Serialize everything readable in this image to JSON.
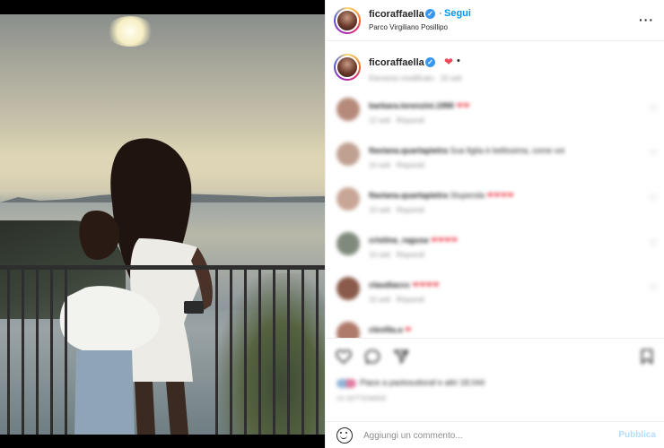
{
  "post": {
    "username": "ficoraffaella",
    "verified": true,
    "follow_label": "Segui",
    "location": "Parco Virgiliano Posillipo",
    "more_icon": "more-horizontal-icon"
  },
  "caption": {
    "username": "ficoraffaella",
    "heart": "❤",
    "suffix": "•",
    "meta": "Elemento modificato · 19 sett"
  },
  "comments": [
    {
      "user": "barbara.lorenzini.1990",
      "text": "",
      "hearts": "❤❤",
      "time": "12 sett",
      "reply": "Rispondi"
    },
    {
      "user": "flaviana.quartapietra",
      "text": "Sua figlia è bellissima, come voi",
      "hearts": "",
      "time": "10 sett",
      "reply": "Rispondi"
    },
    {
      "user": "flaviana.quartapietra",
      "text": "Stupenda",
      "hearts": "❤❤❤❤",
      "time": "10 sett",
      "reply": "Rispondi"
    },
    {
      "user": "cristina_ragusa",
      "text": "",
      "hearts": "❤❤❤❤",
      "time": "10 sett",
      "reply": "Rispondi"
    },
    {
      "user": "claudiaccc",
      "text": "",
      "hearts": "❤❤❤❤",
      "time": "10 sett",
      "reply": "Rispondi"
    },
    {
      "user": "clevilla.a",
      "text": "",
      "hearts": "❤",
      "time": "",
      "reply": ""
    }
  ],
  "actions": {
    "like_icon": "heart-outline-icon",
    "comment_icon": "comment-icon",
    "share_icon": "paper-plane-icon",
    "save_icon": "bookmark-icon",
    "likes_text": "Piace a paolosuttoraf e altri 18.044",
    "date_text": "19 SETTEMBRE"
  },
  "add_comment": {
    "placeholder": "Aggiungi un commento...",
    "publish_label": "Pubblica"
  },
  "colors": {
    "link_blue": "#0095f6",
    "heart_red": "#ed4956",
    "muted_gray": "#8e8e8e",
    "publish_disabled": "#b2dffc"
  }
}
